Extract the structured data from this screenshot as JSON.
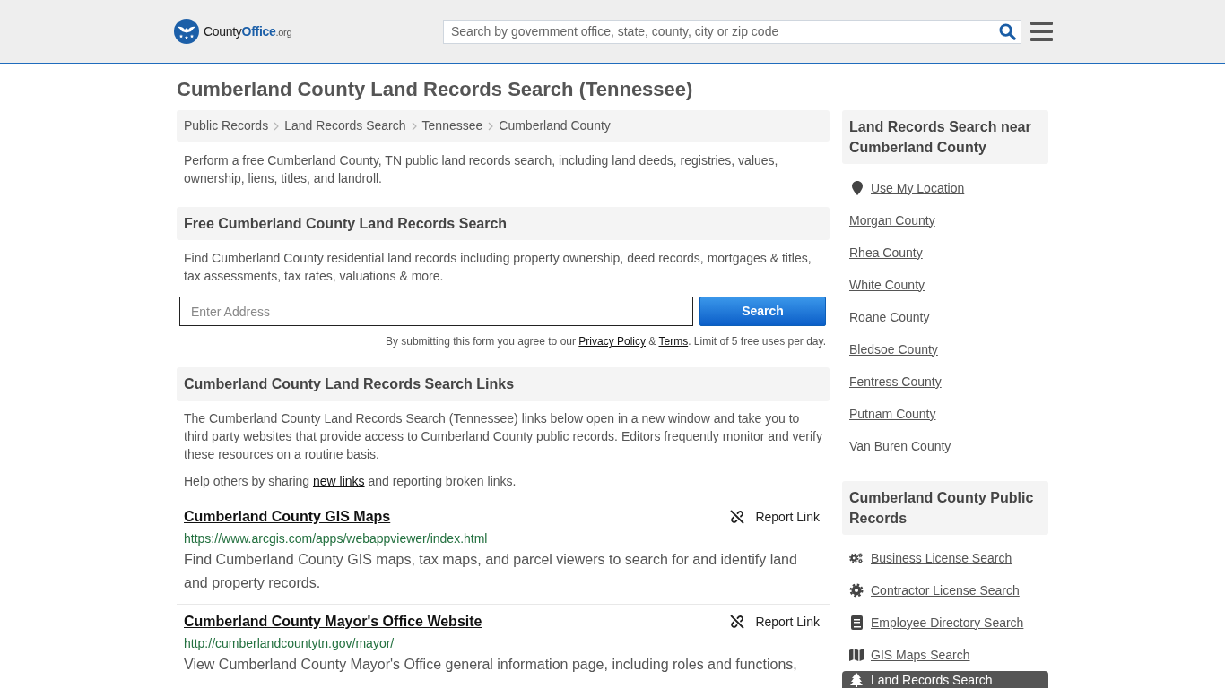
{
  "header": {
    "logo": {
      "parts": [
        {
          "kind": "plain",
          "text": "County"
        },
        {
          "kind": "brand",
          "text": "Office"
        },
        {
          "kind": "small",
          "text": ".org"
        }
      ]
    },
    "search": {
      "placeholder": "Search by government office, state, county, city or zip code"
    }
  },
  "page_title": "Cumberland County Land Records Search (Tennessee)",
  "breadcrumbs": [
    "Public Records",
    "Land Records Search",
    "Tennessee",
    "Cumberland County"
  ],
  "intro": "Perform a free Cumberland County, TN public land records search, including land deeds, registries, values, ownership, liens, titles, and landroll.",
  "search_section": {
    "heading": "Free Cumberland County Land Records Search",
    "text": "Find Cumberland County residential land records including property ownership, deed records, mortgages & titles, tax assessments, tax rates, valuations & more.",
    "address_field": {
      "placeholder": "Enter Address"
    },
    "button": "Search",
    "disclaimer": [
      {
        "kind": "text",
        "text": "By submitting this form you agree to our "
      },
      {
        "kind": "link",
        "text": "Privacy Policy"
      },
      {
        "kind": "text",
        "text": " & "
      },
      {
        "kind": "link",
        "text": "Terms"
      },
      {
        "kind": "text",
        "text": ". Limit of 5 free uses per day."
      }
    ]
  },
  "links_section": {
    "heading": "Cumberland County Land Records Search Links",
    "text": "The Cumberland County Land Records Search (Tennessee) links below open in a new window and take you to third party websites that provide access to Cumberland County public records. Editors frequently monitor and verify these resources on a routine basis.",
    "help": [
      {
        "kind": "text",
        "text": "Help others by sharing "
      },
      {
        "kind": "link",
        "text": "new links"
      },
      {
        "kind": "text",
        "text": " and reporting broken links."
      }
    ],
    "links": [
      {
        "title": "Cumberland County GIS Maps",
        "url": "https://www.arcgis.com/apps/webappviewer/index.html",
        "description": "Find Cumberland County GIS maps, tax maps, and parcel viewers to search for and identify land and property records.",
        "report": "Report Link"
      },
      {
        "title": "Cumberland County Mayor's Office Website",
        "url": "http://cumberlandcountytn.gov/mayor/",
        "description": "View Cumberland County Mayor's Office general information page, including roles and functions,",
        "report": "Report Link"
      }
    ]
  },
  "sidebar": {
    "nearby": {
      "heading": "Land Records Search near Cumberland County",
      "location_link": "Use My Location",
      "counties": [
        "Morgan County",
        "Rhea County",
        "White County",
        "Roane County",
        "Bledsoe County",
        "Fentress County",
        "Putnam County",
        "Van Buren County"
      ]
    },
    "public_records": {
      "heading": "Cumberland County Public Records",
      "items": [
        {
          "label": "Business License Search",
          "selected": false
        },
        {
          "label": "Contractor License Search",
          "selected": false
        },
        {
          "label": "Employee Directory Search",
          "selected": false
        },
        {
          "label": "GIS Maps Search",
          "selected": false
        },
        {
          "label": "Land Records Search",
          "selected": true
        }
      ]
    }
  }
}
